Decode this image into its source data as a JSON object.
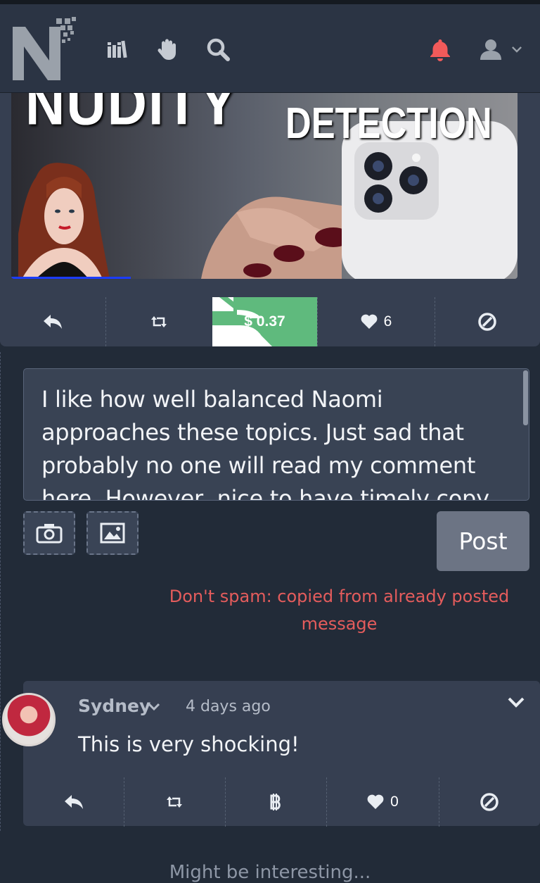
{
  "nav": {
    "icons": [
      "library-icon",
      "hand-icon",
      "search-icon",
      "bell-icon",
      "user-icon",
      "chevron-down-icon"
    ],
    "bell_color": "#f25a5a"
  },
  "post": {
    "thumbnail_title_word1": "NUDITY",
    "thumbnail_title_word2": "DETECTION",
    "tip_amount": "$ 0.37",
    "like_count": "6"
  },
  "editor": {
    "text": "I like how well balanced Naomi approaches these topics. Just sad that probably no one will read my comment here. However, nice to have timely copy"
  },
  "post_button_label": "Post",
  "spam_warning": "Don't spam: copied from already posted message",
  "reply": {
    "author": "Sydney",
    "time": "4 days ago",
    "text": "This is very shocking!",
    "like_count": "0"
  },
  "footer": {
    "text": "Might be interesting..."
  },
  "colors": {
    "background": "#222b38",
    "card": "#363f51",
    "tip_green": "#5fba7d",
    "spam_red": "#e45c5c"
  }
}
